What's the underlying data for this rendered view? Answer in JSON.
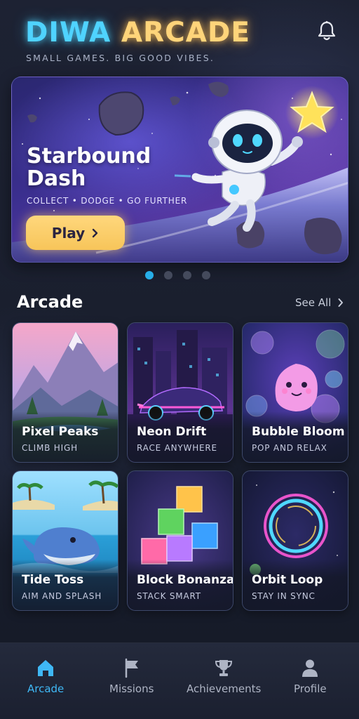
{
  "app": {
    "title_part1": "DIWA",
    "title_part2": "ARCADE",
    "tagline": "SMALL GAMES. BIG GOOD VIBES."
  },
  "header": {
    "notification_icon": "bell-icon"
  },
  "hero": {
    "title": "Starbound Dash",
    "subtitle": "COLLECT • DODGE • GO FURTHER",
    "play_label": "Play",
    "play_icon": "chevron-right-icon",
    "carousel": {
      "count": 4,
      "active_index": 0
    }
  },
  "section": {
    "title": "Arcade",
    "see_all_label": "See All",
    "see_all_icon": "chevron-right-icon"
  },
  "games": [
    {
      "name": "Pixel Peaks",
      "tagline": "CLIMB HIGH"
    },
    {
      "name": "Neon Drift",
      "tagline": "RACE ANYWHERE"
    },
    {
      "name": "Bubble Bloom",
      "tagline": "POP AND RELAX"
    },
    {
      "name": "Tide Toss",
      "tagline": "AIM AND SPLASH"
    },
    {
      "name": "Block Bonanza",
      "tagline": "STACK SMART"
    },
    {
      "name": "Orbit Loop",
      "tagline": "STAY IN SYNC"
    }
  ],
  "nav": {
    "items": [
      {
        "label": "Arcade",
        "icon": "home-icon",
        "active": true
      },
      {
        "label": "Missions",
        "icon": "flag-icon",
        "active": false
      },
      {
        "label": "Achievements",
        "icon": "trophy-icon",
        "active": false
      },
      {
        "label": "Profile",
        "icon": "person-icon",
        "active": false
      }
    ]
  },
  "colors": {
    "accent_blue": "#27aee8",
    "accent_gold": "#f7c55a",
    "background": "#171c2b"
  }
}
